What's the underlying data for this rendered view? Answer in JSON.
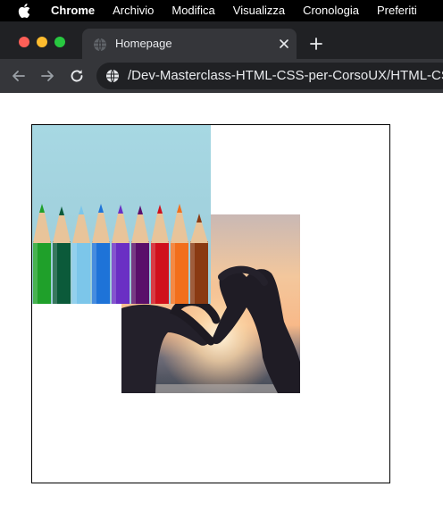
{
  "menubar": {
    "app_name": "Chrome",
    "items": [
      "Archivio",
      "Modifica",
      "Visualizza",
      "Cronologia",
      "Preferiti"
    ]
  },
  "tabstrip": {
    "tab_title": "Homepage"
  },
  "toolbar": {
    "url": "/Dev-Masterclass-HTML-CSS-per-CorsoUX/HTML-CSS-DEV-Masterclass"
  },
  "icons": {
    "apple": "apple-logo-icon",
    "favicon": "globe-icon",
    "close": "close-icon",
    "new_tab": "plus-icon",
    "back": "arrow-left-icon",
    "forward": "arrow-right-icon",
    "reload": "reload-icon",
    "site_info": "globe-icon"
  },
  "colors": {
    "menubar": "#000000",
    "tabstrip": "#202124",
    "active_tab": "#35363a",
    "traffic_close": "#fe5f57",
    "traffic_minimize": "#febc2e",
    "traffic_zoom": "#28c840"
  }
}
